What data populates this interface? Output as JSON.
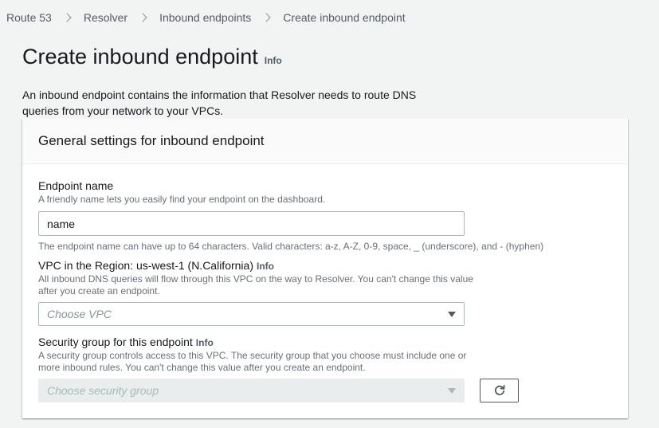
{
  "breadcrumb": [
    {
      "label": "Route 53"
    },
    {
      "label": "Resolver"
    },
    {
      "label": "Inbound endpoints"
    },
    {
      "label": "Create inbound endpoint"
    }
  ],
  "page": {
    "title": "Create inbound endpoint",
    "info_label": "Info",
    "description": "An inbound endpoint contains the information that Resolver needs to route DNS queries from your network to your VPCs."
  },
  "panel": {
    "title": "General settings for inbound endpoint"
  },
  "endpoint_name": {
    "label": "Endpoint name",
    "hint": "A friendly name lets you easily find your endpoint on the dashboard.",
    "value": "name",
    "constraint": "The endpoint name can have up to 64 characters. Valid characters: a-z, A-Z, 0-9, space, _ (underscore), and - (hyphen)"
  },
  "vpc": {
    "label": "VPC in the Region: us-west-1 (N.California)",
    "info_label": "Info",
    "hint": "All inbound DNS queries will flow through this VPC on the way to Resolver. You can't change this value after you create an endpoint.",
    "placeholder": "Choose VPC"
  },
  "security_group": {
    "label": "Security group for this endpoint",
    "info_label": "Info",
    "hint": "A security group controls access to this VPC. The security group that you choose must include one or more inbound rules. You can't change this value after you create an endpoint.",
    "placeholder": "Choose security group",
    "disabled": true
  },
  "icons": {
    "breadcrumb_separator": "chevron-right-icon",
    "select_caret": "caret-down-icon",
    "refresh": "refresh-icon"
  },
  "colors": {
    "background": "#f2f3f3",
    "panel": "#ffffff",
    "text": "#16191f",
    "muted": "#687078",
    "border": "#aab7b8"
  }
}
